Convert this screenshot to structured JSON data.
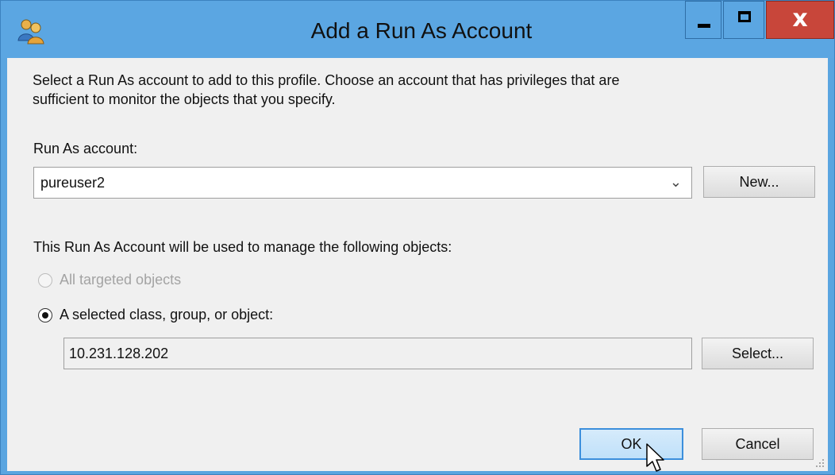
{
  "window": {
    "title": "Add a Run As Account",
    "icon": "run-as-account-people-icon",
    "controls": {
      "minimize": "minimize-icon",
      "maximize": "maximize-icon",
      "close_glyph": "x"
    },
    "accent_color": "#5ba6e2",
    "close_color": "#c8463a"
  },
  "dialog": {
    "intro_line1": "Select a Run As account to add to this profile.  Choose an account that has privileges that are",
    "intro_line2": "sufficient to monitor the objects that you specify.",
    "account_label": "Run As account:",
    "account_value": "pureuser2",
    "new_button": "New...",
    "manage_label": "This Run As Account will be used to manage the following objects:",
    "option_all": "All targeted objects",
    "option_selected": "A selected class, group, or object:",
    "selected_object": "10.231.128.202",
    "select_button": "Select...",
    "ok_button": "OK",
    "cancel_button": "Cancel"
  }
}
